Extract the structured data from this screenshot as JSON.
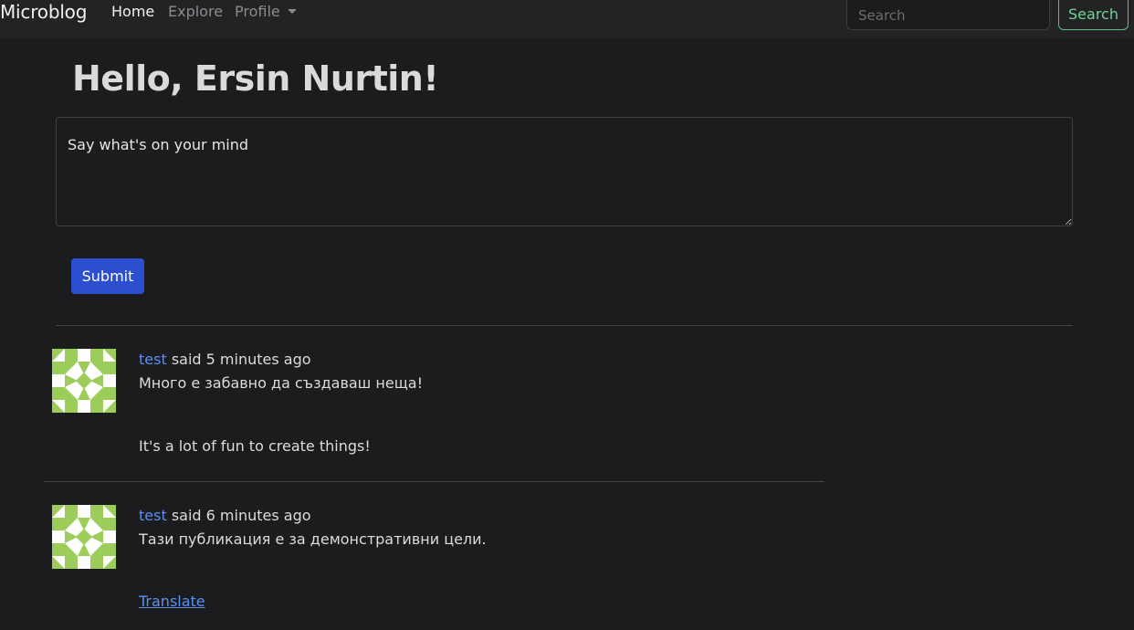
{
  "navbar": {
    "brand": "Microblog",
    "items": [
      {
        "label": "Home",
        "active": true
      },
      {
        "label": "Explore"
      },
      {
        "label": "Profile"
      }
    ],
    "search_placeholder": "Search",
    "search_button": "Search",
    "search_button_color": "#6fd39a"
  },
  "main": {
    "greeting": "Hello, Ersin Nurtin!",
    "textarea_placeholder": "Say what's on your mind",
    "submit_label": "Submit",
    "submit_color": "#2b4fcf"
  },
  "posts": [
    {
      "username": "test",
      "said_text": " said 5 minutes ago",
      "body": "Много е забавно да създаваш неща!",
      "translation": "It's a lot of fun to create things!",
      "avatar_icon": "identicon-avatar"
    },
    {
      "username": "test",
      "said_text": " said 6 minutes ago",
      "body": "Тази публикация е за демонстративни цели.",
      "translate_label": "Translate",
      "avatar_icon": "identicon-avatar"
    }
  ],
  "colors": {
    "background": "#1c1c1e",
    "navbar": "#232325",
    "link": "#5a8ff0",
    "identicon_green": "#9ccc5a"
  }
}
